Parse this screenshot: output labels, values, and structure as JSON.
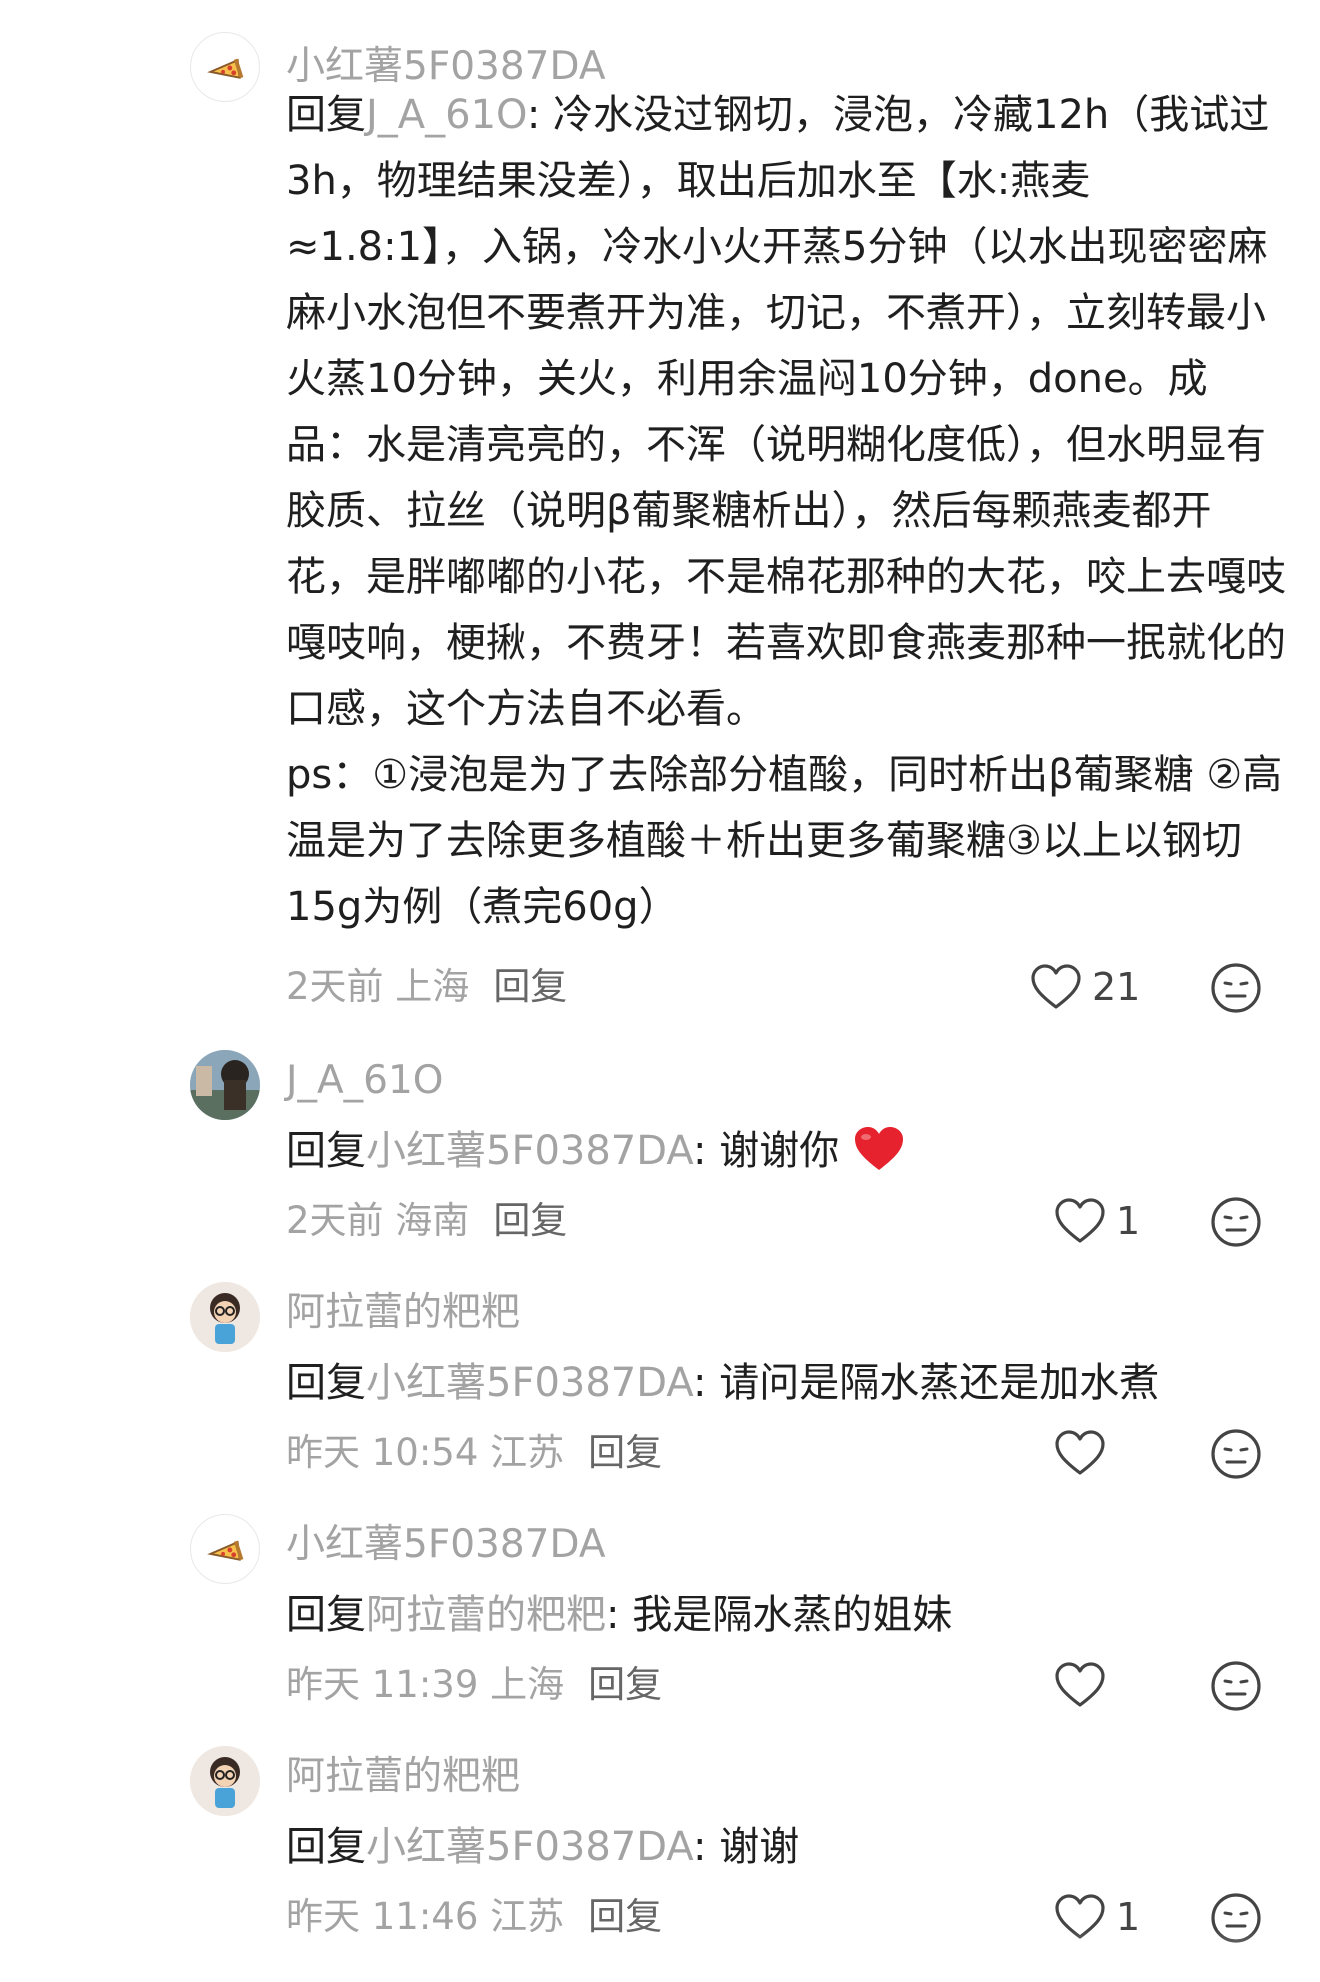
{
  "comments": [
    {
      "username": "小红薯5F0387DA",
      "reply_prefix": "回复",
      "mention": "J_A_61O",
      "text": ": 冷水没过钢切，浸泡，冷藏12h（我试过3h，物理结果没差），取出后加水至【水:燕麦≈1.8:1】，入锅，冷水小火开蒸5分钟（以水出现密密麻麻小水泡但不要煮开为准，切记，不煮开），立刻转最小火蒸10分钟，关火，利用余温闷10分钟，done。成品：水是清亮亮的，不浑（说明糊化度低），但水明显有胶质、拉丝（说明β葡聚糖析出），然后每颗燕麦都开花，是胖嘟嘟的小花，不是棉花那种的大花，咬上去嘎吱嘎吱响，梗揪，不费牙！若喜欢即食燕麦那种一抿就化的口感，这个方法自不必看。",
      "ps": "ps：①浸泡是为了去除部分植酸，同时析出β葡聚糖 ②高温是为了去除更多植酸＋析出更多葡聚糖③以上以钢切15g为例（煮完60g）",
      "time_location": "2天前 上海",
      "reply_label": "回复",
      "likes": "21"
    },
    {
      "username": "J_A_61O",
      "reply_prefix": "回复",
      "mention": "小红薯5F0387DA",
      "text": ": 谢谢你",
      "time_location": "2天前 海南",
      "reply_label": "回复",
      "likes": "1"
    },
    {
      "username": "阿拉蕾的粑粑",
      "reply_prefix": "回复",
      "mention": "小红薯5F0387DA",
      "text": ": 请问是隔水蒸还是加水煮",
      "time_location": "昨天 10:54 江苏",
      "reply_label": "回复",
      "likes": ""
    },
    {
      "username": "小红薯5F0387DA",
      "reply_prefix": "回复",
      "mention": "阿拉蕾的粑粑",
      "text": ": 我是隔水蒸的姐妹",
      "time_location": "昨天 11:39 上海",
      "reply_label": "回复",
      "likes": ""
    },
    {
      "username": "阿拉蕾的粑粑",
      "reply_prefix": "回复",
      "mention": "小红薯5F0387DA",
      "text": ": 谢谢",
      "time_location": "昨天 11:46 江苏",
      "reply_label": "回复",
      "likes": "1"
    }
  ],
  "icons": {
    "like": "heart-outline-icon",
    "dislike": "neutral-face-icon",
    "emoji": "red-heart-emoji",
    "avatar_pizza": "pizza-slice-icon"
  },
  "colors": {
    "muted": "#a3a3a3",
    "text": "#1f1f1f",
    "heart_emoji": "#e5222d"
  }
}
